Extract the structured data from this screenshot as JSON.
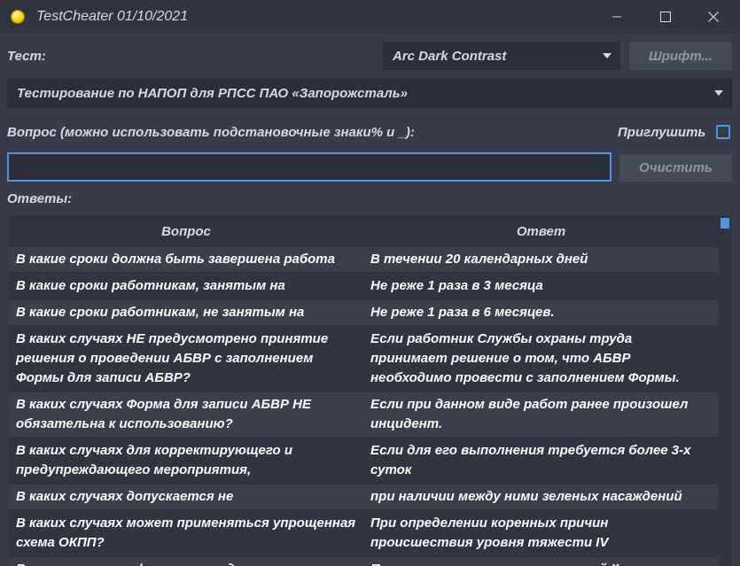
{
  "window": {
    "title": "TestCheater 01/10/2021"
  },
  "toolbar": {
    "test_label": "Тест:",
    "theme_value": "Arc Dark Contrast",
    "font_button": "Шрифт..."
  },
  "test_select": {
    "value": "Тестирование по НАПОП для РПСС ПАО «Запорожсталь»"
  },
  "question": {
    "label": "Вопрос (можно использовать подстановочные знаки% и _):",
    "mute_label": "Приглушить",
    "mute_checked": false,
    "value": "",
    "clear_button": "Очистить"
  },
  "answers": {
    "label": "Ответы:",
    "columns": [
      "Вопрос",
      "Ответ"
    ],
    "rows": [
      {
        "q": "В какие сроки должна быть завершена работа",
        "a": "В течении 20 календарных дней"
      },
      {
        "q": "В какие сроки работникам, занятым на",
        "a": "Не реже 1 раза в 3 месяца"
      },
      {
        "q": "В какие сроки работникам, не занятым на",
        "a": "Не реже 1 раза в 6 месяцев."
      },
      {
        "q": "В каких случаях НЕ предусмотрено принятие решения о проведении АБВР с заполнением Формы для записи АБВР?",
        "a": "Если работник Службы охраны труда принимает решение о том, что АБВР необходимо провести с заполнением Формы."
      },
      {
        "q": "В каких случаях Форма для записи АБВР НЕ обязательна к использованию?",
        "a": "Если при данном виде работ ранее произошел инцидент."
      },
      {
        "q": "В каких случаях для корректирующего и предупреждающего мероприятия,",
        "a": "Если для его выполнения требуется более 3-х суток"
      },
      {
        "q": "В каких случаях допускается не",
        "a": "при наличии между ними зеленых насаждений"
      },
      {
        "q": "В каких случаях может применяться упрощенная схема ОКПП?",
        "a": "При определении коренных причин происшествия уровня тяжести IV"
      },
      {
        "q": "В каких случаях оформляется документ в",
        "a": "При возникновении происшествий II уровня"
      }
    ]
  },
  "colors": {
    "accent": "#5294e2",
    "background": "#383c4a",
    "titlebar": "#2f343f"
  }
}
